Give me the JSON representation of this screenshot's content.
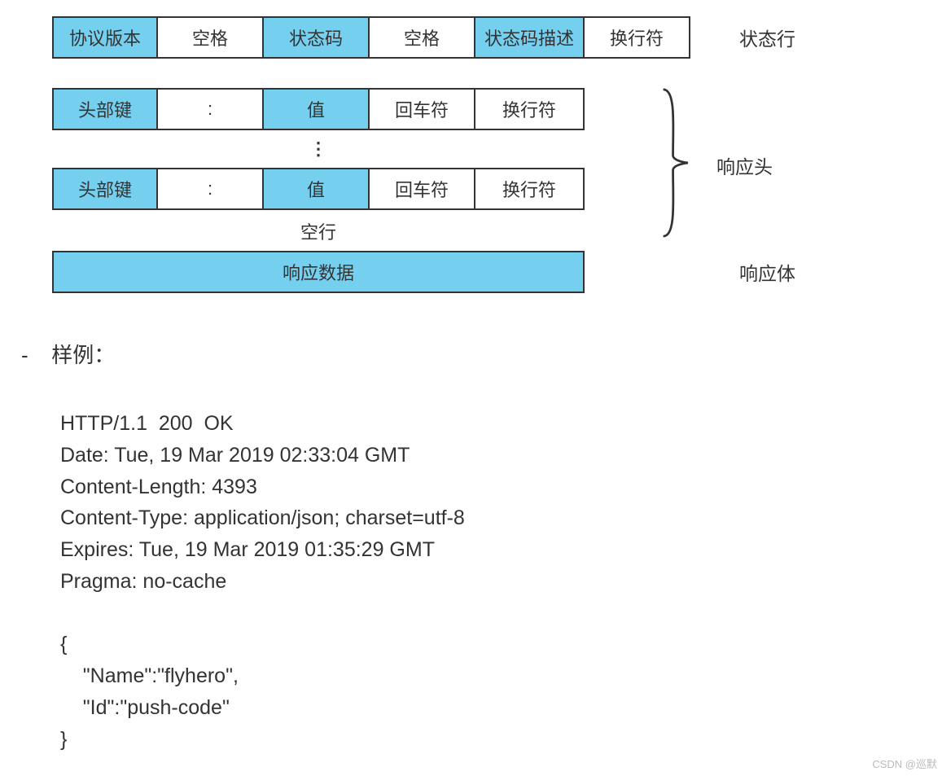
{
  "colors": {
    "accent": "#75cfee"
  },
  "diagram": {
    "status_line": {
      "cells": [
        "协议版本",
        "空格",
        "状态码",
        "空格",
        "状态码描述",
        "换行符"
      ],
      "label": "状态行"
    },
    "header_row": {
      "cells": [
        "头部键",
        ":",
        "值",
        "回车符",
        "换行符"
      ]
    },
    "headers_label": "响应头",
    "blank_line": "空行",
    "body_bar": "响应数据",
    "body_label": "响应体"
  },
  "example": {
    "title": "样例：",
    "lines": [
      "HTTP/1.1  200  OK",
      "Date: Tue, 19 Mar 2019 02:33:04 GMT",
      "Content-Length: 4393",
      "Content-Type: application/json; charset=utf-8",
      "Expires: Tue, 19 Mar 2019 01:35:29 GMT",
      "Pragma: no-cache",
      "",
      "{",
      "    \"Name\":\"flyhero\",",
      "    \"Id\":\"push-code\"",
      "}"
    ]
  },
  "watermark": "CSDN @巡默"
}
